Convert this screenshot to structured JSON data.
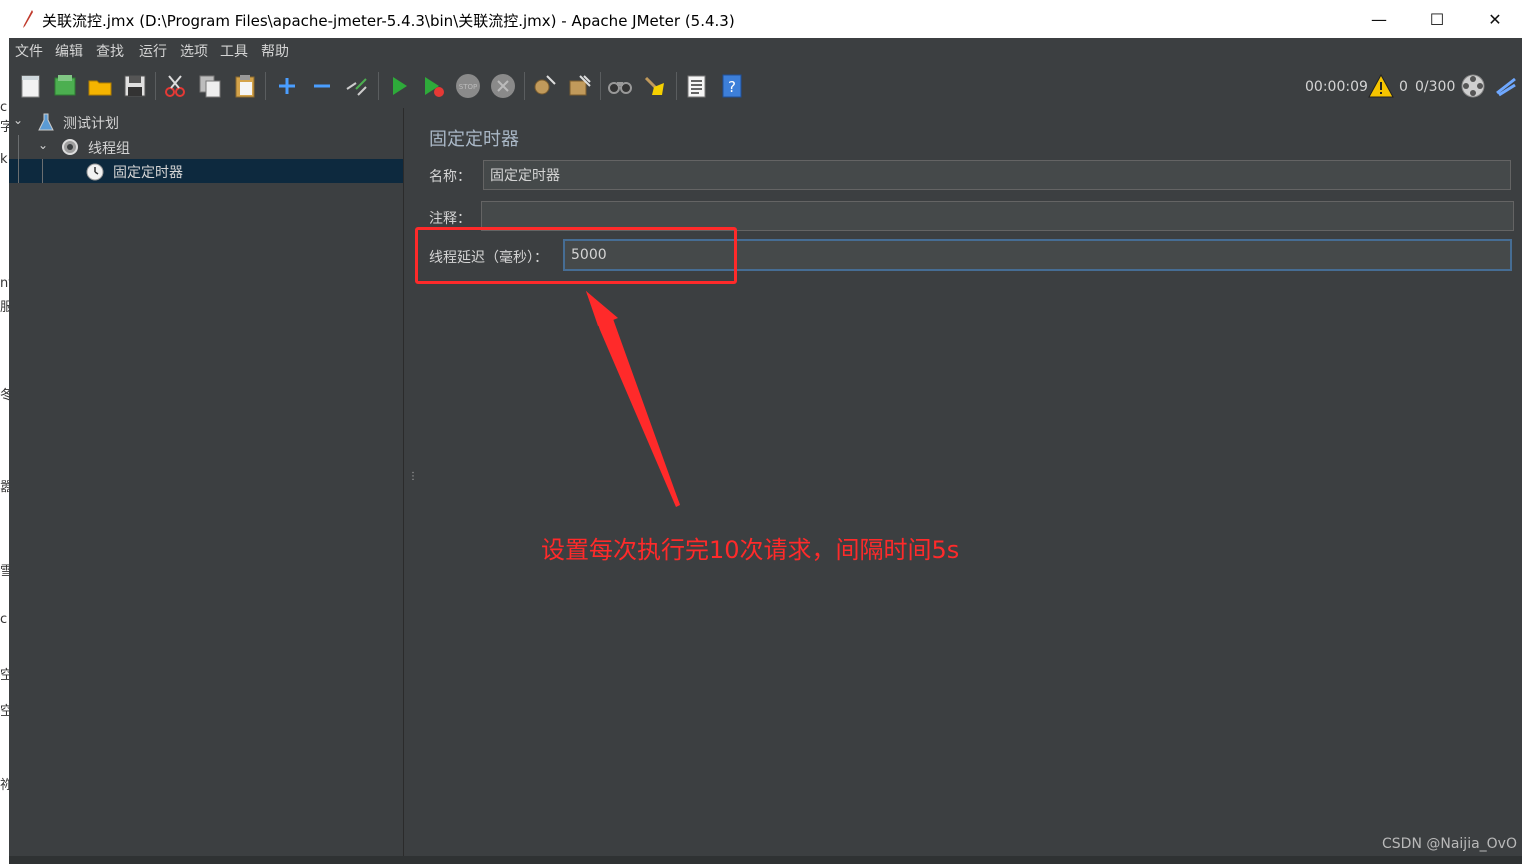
{
  "window": {
    "title": "关联流控.jmx (D:\\Program Files\\apache-jmeter-5.4.3\\bin\\关联流控.jmx) - Apache JMeter (5.4.3)",
    "minimize": "—",
    "maximize": "☐",
    "close": "✕"
  },
  "left_strip_fragments": [
    "c",
    "字",
    "k",
    "nt",
    "服",
    "冬",
    "嚣",
    "雪",
    "c",
    "空",
    "空",
    "祢"
  ],
  "menu": [
    "文件",
    "编辑",
    "查找",
    "运行",
    "选项",
    "工具",
    "帮助"
  ],
  "toolbar": {
    "icons": [
      "new-icon",
      "templates-icon",
      "open-icon",
      "save-icon",
      "cut-icon",
      "copy-icon",
      "paste-icon",
      "expand-icon",
      "collapse-icon",
      "toggle-icon",
      "start-icon",
      "start-no-pause-icon",
      "stop-icon",
      "shutdown-icon",
      "clear-icon",
      "clear-all-icon",
      "search-icon",
      "reset-search-icon",
      "function-helper-icon",
      "help-icon"
    ],
    "elapsed": "00:00:09",
    "error_count": "0",
    "threads": "0/300"
  },
  "tree": [
    {
      "label": "测试计划",
      "level": 0,
      "icon": "test-plan-icon"
    },
    {
      "label": "线程组",
      "level": 1,
      "icon": "thread-group-icon"
    },
    {
      "label": "固定定时器",
      "level": 2,
      "icon": "timer-icon",
      "selected": true
    }
  ],
  "panel": {
    "title": "固定定时器",
    "name_label": "名称：",
    "name_value": "固定定时器",
    "comment_label": "注释：",
    "comment_value": "",
    "delay_label": "线程延迟（毫秒）：",
    "delay_value": "5000"
  },
  "annotation": {
    "text": "设置每次执行完10次请求，间隔时间5s",
    "color": "#ff2a2a"
  },
  "watermark": "CSDN @Naijia_OvO"
}
